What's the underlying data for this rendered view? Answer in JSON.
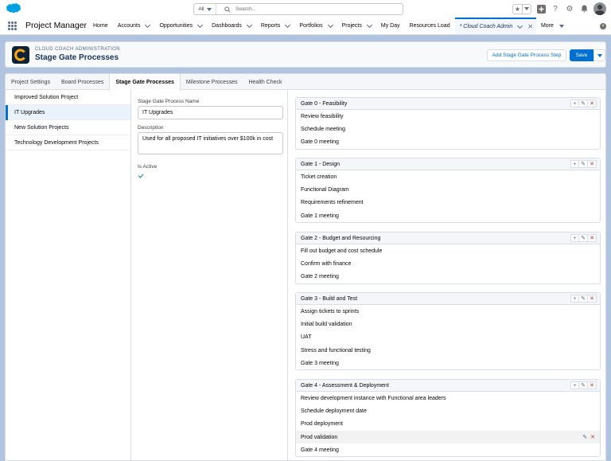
{
  "global_header": {
    "search_scope": "All",
    "search_placeholder": "Search..."
  },
  "nav": {
    "app_name": "Project Manager",
    "items": [
      {
        "label": "Home",
        "has_menu": false
      },
      {
        "label": "Accounts",
        "has_menu": true
      },
      {
        "label": "Opportunities",
        "has_menu": true
      },
      {
        "label": "Dashboards",
        "has_menu": true
      },
      {
        "label": "Reports",
        "has_menu": true
      },
      {
        "label": "Portfolios",
        "has_menu": true
      },
      {
        "label": "Projects",
        "has_menu": true
      },
      {
        "label": "My Day",
        "has_menu": false
      },
      {
        "label": "Resources Load",
        "has_menu": false
      }
    ],
    "active_tab": "* Cloud Coach Admin",
    "more_label": "More"
  },
  "page_header": {
    "eyebrow": "CLOUD COACH ADMINISTRATION",
    "title": "Stage Gate Processes",
    "add_step_label": "Add Stage Gate Process Step",
    "save_label": "Save"
  },
  "tabs": [
    {
      "label": "Project Settings",
      "active": false
    },
    {
      "label": "Board Processes",
      "active": false
    },
    {
      "label": "Stage Gate Processes",
      "active": true
    },
    {
      "label": "Milestone Processes",
      "active": false
    },
    {
      "label": "Health Check",
      "active": false
    }
  ],
  "processes": [
    {
      "label": "Improved Solution Project",
      "selected": false
    },
    {
      "label": "IT Upgrades",
      "selected": true
    },
    {
      "label": "New Solution Projects",
      "selected": false
    },
    {
      "label": "Technology Development Projects",
      "selected": false
    }
  ],
  "form": {
    "name_label": "Stage Gate Process Name",
    "name_value": "IT Upgrades",
    "description_label": "Description",
    "description_value": "Used for all proposed IT initiatives over $100k in cost",
    "active_label": "Is Active",
    "is_active": true
  },
  "gates": [
    {
      "title": "Gate 0 - Feasibility",
      "steps": [
        "Review feasibility",
        "Schedule meeting",
        "Gate 0 meeting"
      ]
    },
    {
      "title": "Gate 1 - Design",
      "steps": [
        "Ticket creation",
        "Functional Diagram",
        "Requirements refinement",
        "Gate 1 meeting"
      ]
    },
    {
      "title": "Gate 2 - Budget and Resourcing",
      "steps": [
        "Fill out budget and cost schedule",
        "Confirm with finance",
        "Gate 2 meeting"
      ]
    },
    {
      "title": "Gate 3 - Build and Test",
      "steps": [
        "Assign tickets to sprints",
        "Initial build validation",
        "UAT",
        "Stress and functional testing",
        "Gate 3 meeting"
      ]
    },
    {
      "title": "Gate 4 - Assessment & Deployment",
      "steps": [
        "Review development instance with Functional area leaders",
        "Schedule deployment date",
        "Prod deployment",
        "Prod validation",
        "Gate 4 meeting"
      ]
    }
  ],
  "hovered_step": "Prod validation",
  "colors": {
    "brand_blue": "#0070d2",
    "delete_red": "#c23934"
  }
}
